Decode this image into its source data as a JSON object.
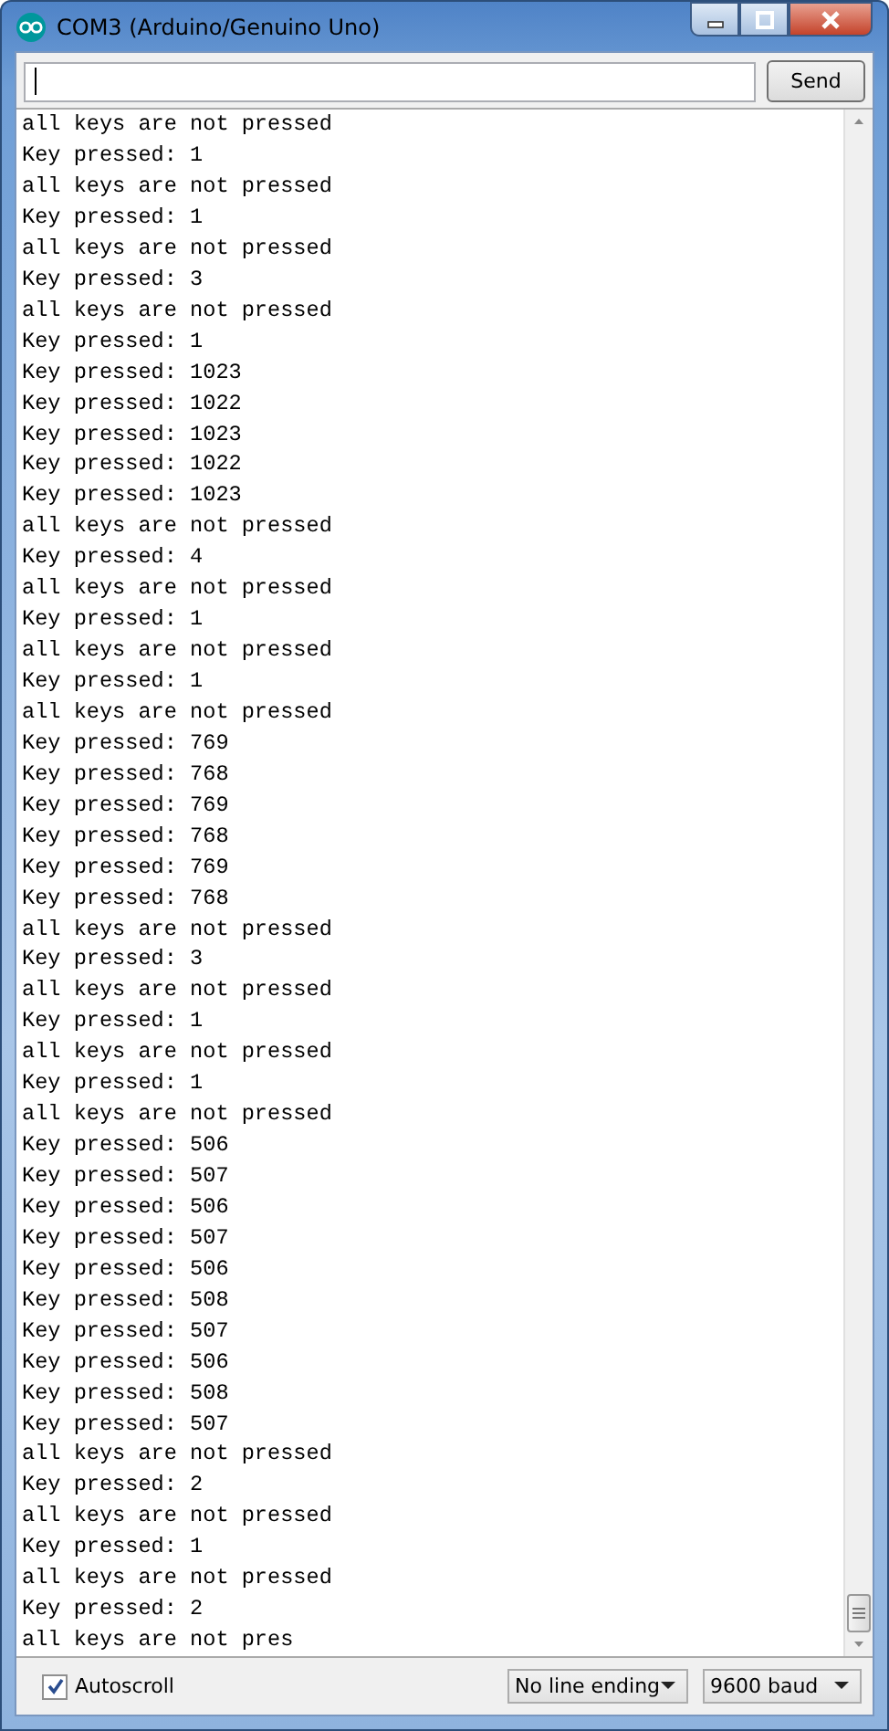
{
  "window": {
    "title": "COM3 (Arduino/Genuino Uno)"
  },
  "input": {
    "send_label": "Send"
  },
  "log": [
    "all keys are not pressed",
    "Key pressed: 1",
    "all keys are not pressed",
    "Key pressed: 1",
    "all keys are not pressed",
    "Key pressed: 3",
    "all keys are not pressed",
    "Key pressed: 1",
    "Key pressed: 1023",
    "Key pressed: 1022",
    "Key pressed: 1023",
    "Key pressed: 1022",
    "Key pressed: 1023",
    "all keys are not pressed",
    "Key pressed: 4",
    "all keys are not pressed",
    "Key pressed: 1",
    "all keys are not pressed",
    "Key pressed: 1",
    "all keys are not pressed",
    "Key pressed: 769",
    "Key pressed: 768",
    "Key pressed: 769",
    "Key pressed: 768",
    "Key pressed: 769",
    "Key pressed: 768",
    "all keys are not pressed",
    "Key pressed: 3",
    "all keys are not pressed",
    "Key pressed: 1",
    "all keys are not pressed",
    "Key pressed: 1",
    "all keys are not pressed",
    "Key pressed: 506",
    "Key pressed: 507",
    "Key pressed: 506",
    "Key pressed: 507",
    "Key pressed: 506",
    "Key pressed: 508",
    "Key pressed: 507",
    "Key pressed: 506",
    "Key pressed: 508",
    "Key pressed: 507",
    "all keys are not pressed",
    "Key pressed: 2",
    "all keys are not pressed",
    "Key pressed: 1",
    "all keys are not pressed",
    "Key pressed: 2",
    "all keys are not pres"
  ],
  "footer": {
    "autoscroll": {
      "label": "Autoscroll",
      "checked": true
    },
    "line_ending": "No line ending",
    "baud": "9600 baud"
  }
}
